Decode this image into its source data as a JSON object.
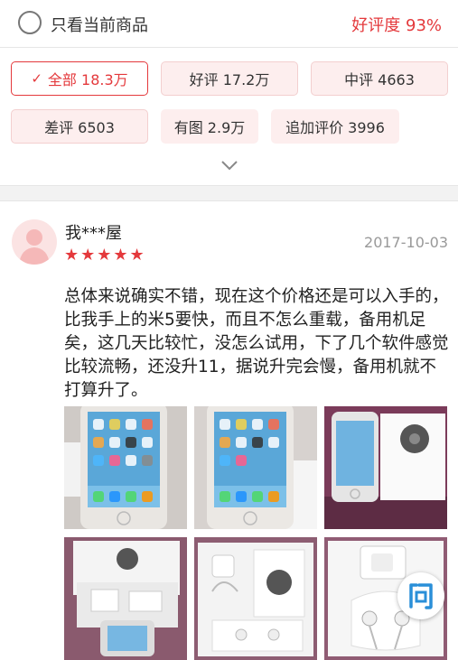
{
  "header": {
    "only_current_label": "只看当前商品",
    "rating_label": "好评度 93%"
  },
  "filters": [
    {
      "label": "全部 18.3万",
      "active": true
    },
    {
      "label": "好评 17.2万"
    },
    {
      "label": "中评 4663"
    },
    {
      "label": "差评 6503"
    },
    {
      "label": "有图 2.9万"
    },
    {
      "label": "追加评价 3996"
    }
  ],
  "review": {
    "username": "我***屋",
    "stars": "★★★★★",
    "star_count": 5,
    "date": "2017-10-03",
    "text": "总体来说确实不错，现在这个价格还是可以入手的，比我手上的米5要快，而且不怎么重载，备用机足矣，这几天比较忙，没怎么试用，下了几个软件感觉比较流畅，还没升11，据说升完会慢，备用机就不打算升了。"
  },
  "ask_button": {
    "label": "问"
  },
  "colors": {
    "accent": "#e4393c",
    "chip_bg": "#fdeeee"
  }
}
